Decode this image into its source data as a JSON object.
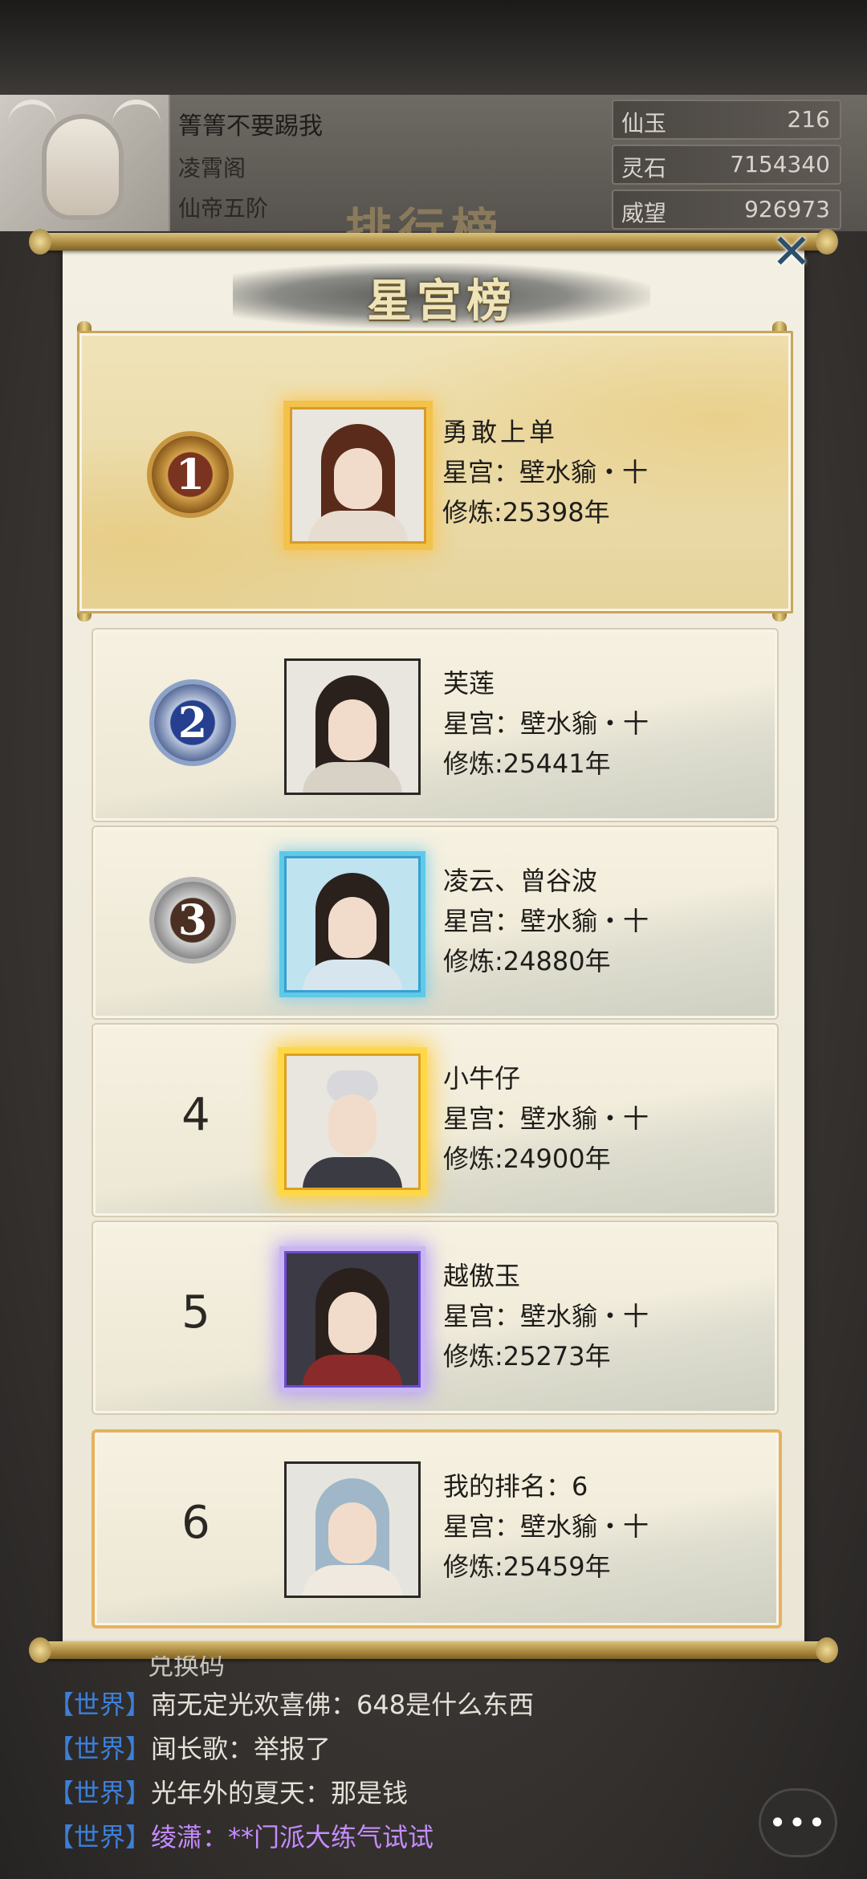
{
  "player": {
    "name": "箐箐不要踢我",
    "sect": "凌霄阁",
    "realm": "仙帝五阶"
  },
  "resources": [
    {
      "label": "仙玉",
      "value": "216"
    },
    {
      "label": "灵石",
      "value": "7154340"
    },
    {
      "label": "威望",
      "value": "926973"
    }
  ],
  "background_title": "排行榜",
  "modal": {
    "title": "星宫榜",
    "close_icon": "close-icon"
  },
  "rankings": [
    {
      "rank": "1",
      "name": "勇敢上单",
      "star_palace": "星宫：壁水貐・十",
      "cultivation": "修炼:25398年"
    },
    {
      "rank": "2",
      "name": "芙莲",
      "star_palace": "星宫：壁水貐・十",
      "cultivation": "修炼:25441年"
    },
    {
      "rank": "3",
      "name": "凌云、曾谷波",
      "star_palace": "星宫：壁水貐・十",
      "cultivation": "修炼:24880年"
    },
    {
      "rank": "4",
      "name": "小牛仔",
      "star_palace": "星宫：壁水貐・十",
      "cultivation": "修炼:24900年"
    },
    {
      "rank": "5",
      "name": "越傲玉",
      "star_palace": "星宫：壁水貐・十",
      "cultivation": "修炼:25273年"
    }
  ],
  "my_rank": {
    "rank": "6",
    "label": "我的排名：6",
    "star_palace": "星宫：壁水貐・十",
    "cultivation": "修炼:25459年"
  },
  "chat": {
    "partial_line": "兑换码",
    "messages": [
      {
        "tag": "【世界】",
        "text": "南无定光欢喜佛：648是什么东西"
      },
      {
        "tag": "【世界】",
        "text": "闻长歌：举报了"
      },
      {
        "tag": "【世界】",
        "text": "光年外的夏天：那是钱"
      },
      {
        "tag": "【世界】",
        "text": "绫潇：**门派大练气试试"
      }
    ],
    "button_icon": "chat-bubble-icon"
  },
  "colors": {
    "chat_tag": "#3d7fd8",
    "chat_text_vip": "#c58cff",
    "mine_border": "#e6b25e",
    "first_border": "#c8a658"
  }
}
